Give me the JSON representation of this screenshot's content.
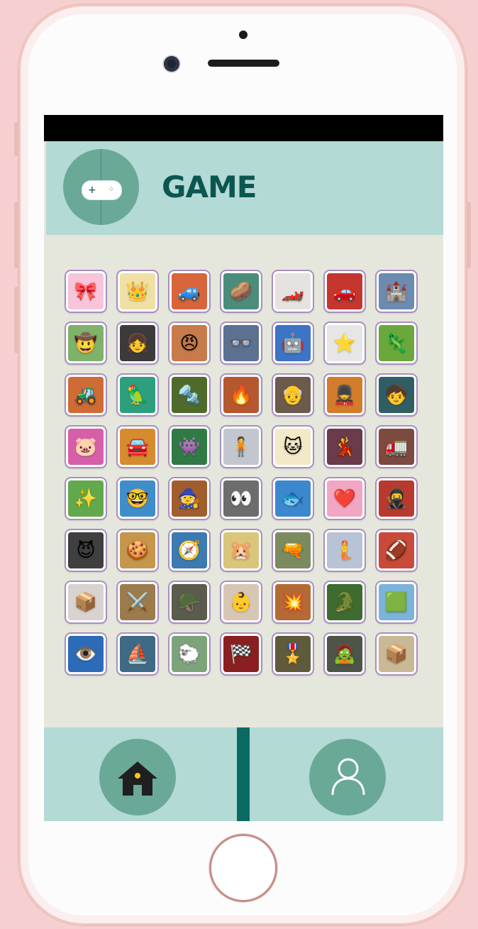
{
  "header": {
    "title": "GAME",
    "logo_icon": "gamepad-icon"
  },
  "games": [
    {
      "icon": "🎀",
      "bg": "#f7c4d9"
    },
    {
      "icon": "👑",
      "bg": "#f0e0a6"
    },
    {
      "icon": "🚙",
      "bg": "#d8643c"
    },
    {
      "icon": "🥔",
      "bg": "#4b8d7a"
    },
    {
      "icon": "🏎️",
      "bg": "#e6e2df"
    },
    {
      "icon": "🚗",
      "bg": "#c5362f"
    },
    {
      "icon": "🏰",
      "bg": "#6b8bb0"
    },
    {
      "icon": "🤠",
      "bg": "#7fb26a"
    },
    {
      "icon": "👧",
      "bg": "#3b3b3b"
    },
    {
      "icon": "😠",
      "bg": "#c77a4a"
    },
    {
      "icon": "👓",
      "bg": "#5c7190"
    },
    {
      "icon": "🤖",
      "bg": "#3c74c6"
    },
    {
      "icon": "⭐",
      "bg": "#e6e6e6"
    },
    {
      "icon": "🦎",
      "bg": "#6aa83b"
    },
    {
      "icon": "🚜",
      "bg": "#cf6b35"
    },
    {
      "icon": "🦜",
      "bg": "#2e9f7e"
    },
    {
      "icon": "🔩",
      "bg": "#4f6b2c"
    },
    {
      "icon": "🔥",
      "bg": "#b5582f"
    },
    {
      "icon": "👴",
      "bg": "#6c5a4c"
    },
    {
      "icon": "💂",
      "bg": "#d27c2c"
    },
    {
      "icon": "🧒",
      "bg": "#2f5f64"
    },
    {
      "icon": "🐷",
      "bg": "#d75fa9"
    },
    {
      "icon": "🚘",
      "bg": "#d68b2e"
    },
    {
      "icon": "👾",
      "bg": "#2f7a45"
    },
    {
      "icon": "🧍",
      "bg": "#c2c7cf"
    },
    {
      "icon": "🐱",
      "bg": "#f2e9c8"
    },
    {
      "icon": "💃",
      "bg": "#6a3b4b"
    },
    {
      "icon": "🚛",
      "bg": "#7d4a3f"
    },
    {
      "icon": "✨",
      "bg": "#62a84d"
    },
    {
      "icon": "🤓",
      "bg": "#3f8ec9"
    },
    {
      "icon": "🧙",
      "bg": "#a25d2f"
    },
    {
      "icon": "👀",
      "bg": "#6d6d6d"
    },
    {
      "icon": "🐟",
      "bg": "#3b88cf"
    },
    {
      "icon": "❤️",
      "bg": "#f2a6c4"
    },
    {
      "icon": "🥷",
      "bg": "#b83a2e"
    },
    {
      "icon": "😈",
      "bg": "#3f3f3f"
    },
    {
      "icon": "🍪",
      "bg": "#c6964d"
    },
    {
      "icon": "🧭",
      "bg": "#3c7ab1"
    },
    {
      "icon": "🐹",
      "bg": "#d9c67b"
    },
    {
      "icon": "🔫",
      "bg": "#7b8a5f"
    },
    {
      "icon": "🧜",
      "bg": "#b9c3d6"
    },
    {
      "icon": "🏈",
      "bg": "#c84a3a"
    },
    {
      "icon": "📦",
      "bg": "#d8d3d0"
    },
    {
      "icon": "⚔️",
      "bg": "#9c7c4e"
    },
    {
      "icon": "🪖",
      "bg": "#5b5b4e"
    },
    {
      "icon": "👶",
      "bg": "#d8c6b5"
    },
    {
      "icon": "💥",
      "bg": "#b56a35"
    },
    {
      "icon": "🐊",
      "bg": "#3e6b2f"
    },
    {
      "icon": "🟩",
      "bg": "#7bb4d8"
    },
    {
      "icon": "👁️",
      "bg": "#2c6bb8"
    },
    {
      "icon": "⛵",
      "bg": "#3f6a86"
    },
    {
      "icon": "🐑",
      "bg": "#7ca37a"
    },
    {
      "icon": "🏁",
      "bg": "#8a1f22"
    },
    {
      "icon": "🎖️",
      "bg": "#5f5a3c"
    },
    {
      "icon": "🧟",
      "bg": "#4c5548"
    },
    {
      "icon": "📦",
      "bg": "#c8b896"
    }
  ],
  "nav": {
    "home_icon": "home-icon",
    "profile_icon": "user-icon"
  }
}
